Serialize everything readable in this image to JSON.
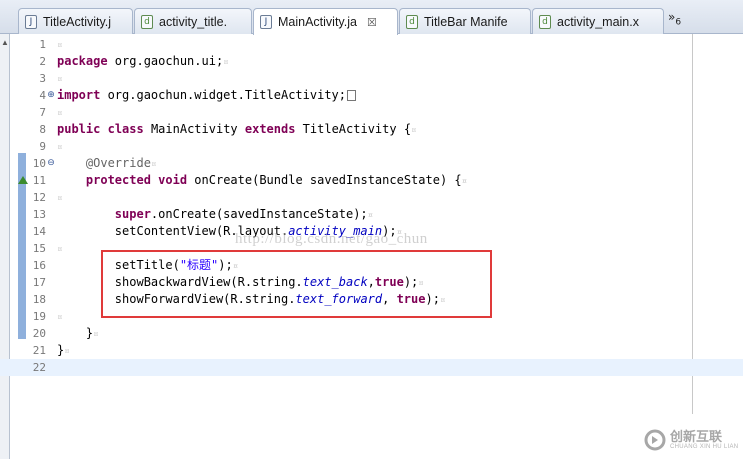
{
  "tabs": [
    {
      "label": "TitleActivity.j",
      "icon": "java-file-icon",
      "glyph": "J",
      "active": false
    },
    {
      "label": "activity_title.",
      "icon": "xml-file-icon",
      "glyph": "d",
      "active": false
    },
    {
      "label": "MainActivity.ja",
      "icon": "java-file-icon",
      "glyph": "J",
      "active": true,
      "close": "☒"
    },
    {
      "label": "TitleBar Manife",
      "icon": "xml-file-icon",
      "glyph": "d",
      "active": false
    },
    {
      "label": "activity_main.x",
      "icon": "xml-file-icon",
      "glyph": "d",
      "active": false
    }
  ],
  "overflow": {
    "label": "»",
    "count": "6"
  },
  "line_numbers": [
    "1",
    "2",
    "3",
    "4",
    "7",
    "8",
    "9",
    "10",
    "11",
    "12",
    "13",
    "14",
    "15",
    "16",
    "17",
    "18",
    "19",
    "20",
    "21",
    "22"
  ],
  "code": {
    "l1": "",
    "l2_kw": "package",
    "l2_rest": " org.gaochun.ui;",
    "l4_kw": "import",
    "l4_rest": " org.gaochun.widget.TitleActivity;",
    "l8_kw1": "public",
    "l8_kw2": "class",
    "l8_name": " MainActivity ",
    "l8_kw3": "extends",
    "l8_rest": " TitleActivity {",
    "l10_ann": "@Override",
    "l11_kw1": "protected",
    "l11_kw2": "void",
    "l11_rest": " onCreate(Bundle savedInstanceState) {",
    "l13_kw": "super",
    "l13_rest": ".onCreate(savedInstanceState);",
    "l14_a": "setContentView(R.layout.",
    "l14_fld": "activity_main",
    "l14_b": ");",
    "l16_a": "setTitle(",
    "l16_str": "\"标题\"",
    "l16_b": ");",
    "l17_a": "showBackwardView(R.string.",
    "l17_fld": "text_back",
    "l17_b": ",",
    "l17_kw": "true",
    "l17_c": ");",
    "l18_a": "showForwardView(R.string.",
    "l18_fld": "text_forward",
    "l18_b": ", ",
    "l18_kw": "true",
    "l18_c": ");",
    "l20": "}",
    "l21": "}"
  },
  "watermark": "http://blog.csdn.net/gao_chun",
  "corner_logo": {
    "cn": "创新互联",
    "en": "CHUANG XIN HU LIAN"
  },
  "markers": {
    "fold_expand": "⊕",
    "fold_collapse": "⊖",
    "pilcrow": "¤"
  },
  "colors": {
    "keyword": "#7f0055",
    "annotation": "#646464",
    "field": "#0000c0",
    "string": "#2a00ff",
    "highlight_box": "#e03a3a",
    "current_line": "#e8f2fe"
  }
}
